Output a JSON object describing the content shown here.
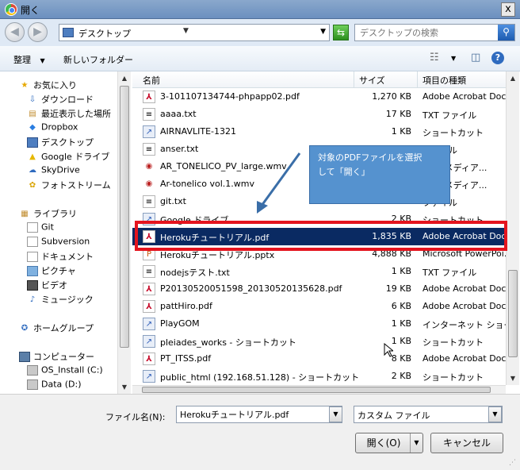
{
  "window": {
    "title": "開く",
    "close": "x"
  },
  "nav": {
    "address": "デスクトップ",
    "search_placeholder": "デスクトップの検索"
  },
  "toolbar": {
    "organize": "整理",
    "new_folder": "新しいフォルダー"
  },
  "sidebar": {
    "favorites_title": "お気に入り",
    "favorites": [
      "ダウンロード",
      "最近表示した場所",
      "Dropbox",
      "デスクトップ",
      "Google ドライブ",
      "SkyDrive",
      "フォトストリーム"
    ],
    "libraries_title": "ライブラリ",
    "libraries": [
      "Git",
      "Subversion",
      "ドキュメント",
      "ピクチャ",
      "ビデオ",
      "ミュージック"
    ],
    "homegroup": "ホームグループ",
    "computer_title": "コンピューター",
    "drives": [
      "OS_Install (C:)",
      "Data (D:)"
    ]
  },
  "columns": {
    "name": "名前",
    "size": "サイズ",
    "type": "項目の種類"
  },
  "files": [
    {
      "name": "3-101107134744-phpapp02.pdf",
      "size": "1,270 KB",
      "type": "Adobe Acrobat Doc.",
      "icon": "pdf-icon"
    },
    {
      "name": "aaaa.txt",
      "size": "17 KB",
      "type": "TXT ファイル",
      "icon": "text-file-icon"
    },
    {
      "name": "AIRNAVLITE-1321",
      "size": "1 KB",
      "type": "ショートカット",
      "icon": "shortcut-icon"
    },
    {
      "name": "anser.txt",
      "size": "",
      "type": "ファイル",
      "icon": "text-file-icon"
    },
    {
      "name": "AR_TONELICO_PV_large.wmv",
      "size": "",
      "type": "layerメディア...",
      "icon": "video-file-icon"
    },
    {
      "name": "Ar-tonelico vol.1.wmv",
      "size": "",
      "type": "layerメディア...",
      "icon": "video-file-icon"
    },
    {
      "name": "git.txt",
      "size": "",
      "type": "ファイル",
      "icon": "text-file-icon"
    },
    {
      "name": "Google ドライブ",
      "size": "2 KB",
      "type": "ショートカット",
      "icon": "shortcut-icon"
    },
    {
      "name": "Herokuチュートリアル.pdf",
      "size": "1,835 KB",
      "type": "Adobe Acrobat Doc.",
      "icon": "pdf-icon",
      "selected": true
    },
    {
      "name": "Herokuチュートリアル.pptx",
      "size": "4,888 KB",
      "type": "Microsoft PowerPoi...",
      "icon": "pptx-icon"
    },
    {
      "name": "nodejsテスト.txt",
      "size": "1 KB",
      "type": "TXT ファイル",
      "icon": "text-file-icon"
    },
    {
      "name": "P20130520051598_20130520135628.pdf",
      "size": "19 KB",
      "type": "Adobe Acrobat Doc.",
      "icon": "pdf-icon"
    },
    {
      "name": "pattHiro.pdf",
      "size": "6 KB",
      "type": "Adobe Acrobat Doc.",
      "icon": "pdf-icon"
    },
    {
      "name": "PlayGOM",
      "size": "1 KB",
      "type": "インターネット ショート...",
      "icon": "shortcut-icon"
    },
    {
      "name": "pleiades_works - ショートカット",
      "size": "1 KB",
      "type": "ショートカット",
      "icon": "shortcut-icon"
    },
    {
      "name": "PT_ITSS.pdf",
      "size": "8 KB",
      "type": "Adobe Acrobat Doc.",
      "icon": "pdf-icon"
    },
    {
      "name": "public_html (192.168.51.128) - ショートカット",
      "size": "2 KB",
      "type": "ショートカット",
      "icon": "shortcut-icon"
    }
  ],
  "callout": {
    "line1": "対象のPDFファイルを選択",
    "line2": "して「開く」"
  },
  "bottom": {
    "filename_label": "ファイル名(N):",
    "filename_value": "Herokuチュートリアル.pdf",
    "filetype": "カスタム ファイル",
    "open_button": "開く(O)",
    "cancel_button": "キャンセル"
  },
  "colors": {
    "selection": "#0a2a62",
    "highlight": "#e4141e",
    "callout": "#5592cf"
  }
}
